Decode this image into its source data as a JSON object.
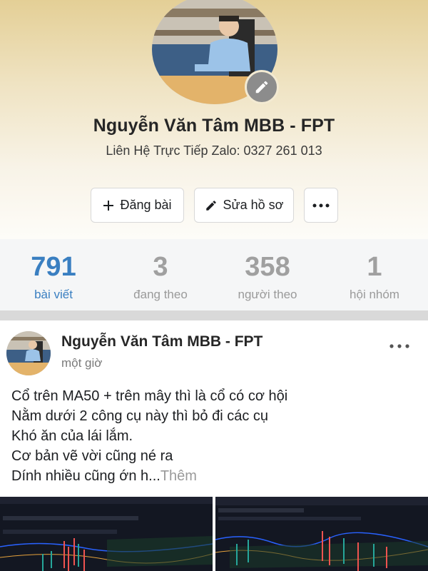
{
  "profile": {
    "name": "Nguyễn Văn Tâm MBB - FPT",
    "bio": "Liên Hệ Trực Tiếp Zalo: 0327 261 013",
    "avatar_icon": "avatar-photo",
    "edit_icon": "pencil-icon"
  },
  "actions": {
    "post_label": "Đăng bài",
    "post_icon": "plus-icon",
    "edit_label": "Sửa hồ sơ",
    "edit_icon": "pencil-icon",
    "more_icon": "more-horizontal-icon"
  },
  "stats": [
    {
      "value": "791",
      "label": "bài viết",
      "active": true
    },
    {
      "value": "3",
      "label": "đang theo",
      "active": false
    },
    {
      "value": "358",
      "label": "người theo",
      "active": false
    },
    {
      "value": "1",
      "label": "hội nhóm",
      "active": false
    }
  ],
  "post": {
    "author": "Nguyễn Văn Tâm MBB - FPT",
    "time": "một giờ",
    "lines": [
      "Cổ trên MA50 + trên mây thì là cổ có cơ hội",
      "Nằm dưới 2 công cụ này thì bỏ đi các cụ",
      "Khó ăn của lái lắm.",
      "Cơ bản vẽ vời cũng né ra"
    ],
    "last_line": "Dính nhiều cũng ớn h...",
    "more_label": "Thêm",
    "more_icon": "more-horizontal-icon"
  },
  "colors": {
    "accent": "#3a7fc1",
    "header_top": "#e4cf96",
    "stats_bg": "#f5f6f7",
    "chart_bg": "#131722"
  }
}
